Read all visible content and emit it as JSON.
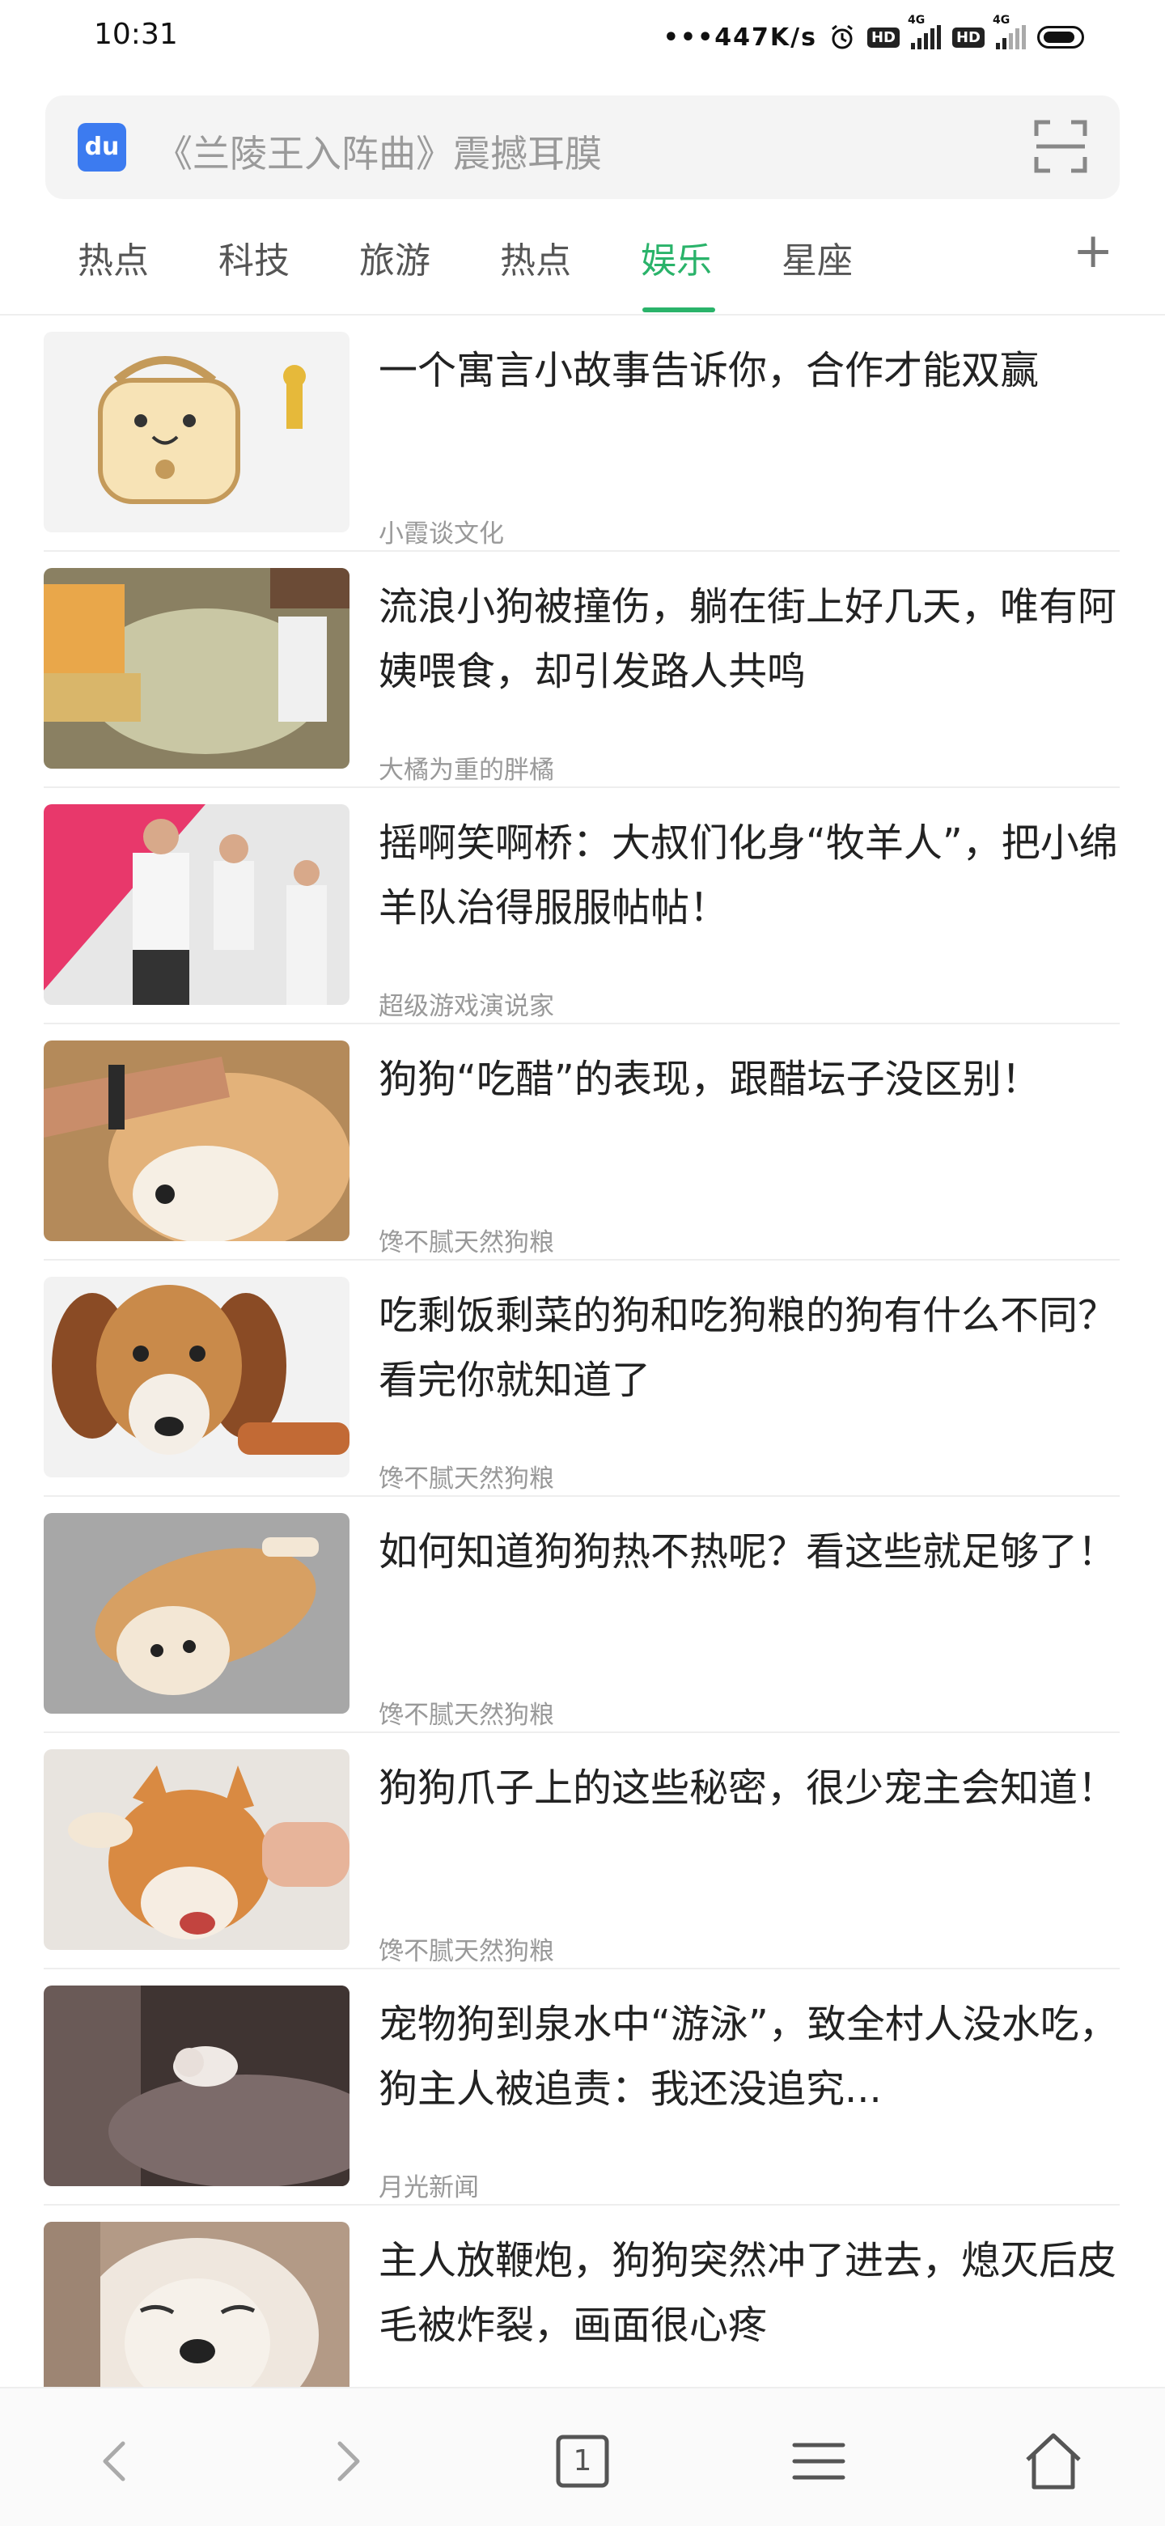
{
  "status_bar": {
    "time": "10:31",
    "network_speed": "•••447K/s",
    "hd": "HD",
    "net": "4G"
  },
  "search": {
    "placeholder": "《兰陵王入阵曲》震撼耳膜",
    "logo_text": "du"
  },
  "tabs": [
    {
      "label": "热点"
    },
    {
      "label": "科技"
    },
    {
      "label": "旅游"
    },
    {
      "label": "热点"
    },
    {
      "label": "娱乐",
      "active": true
    },
    {
      "label": "星座"
    }
  ],
  "tab_add": "+",
  "feed": [
    {
      "title": "一个寓言小故事告诉你，合作才能双赢",
      "source": "小霞谈文化",
      "thumb_icon": "cartoon-handbag-icon"
    },
    {
      "title": "流浪小狗被撞伤，躺在街上好几天，唯有阿姨喂食，却引发路人共鸣",
      "source": "大橘为重的胖橘",
      "thumb_icon": "injured-dog-photo"
    },
    {
      "title": "摇啊笑啊桥：大叔们化身“牧羊人”，把小绵羊队治得服服帖帖！",
      "source": "超级游戏演说家",
      "thumb_icon": "tv-show-photo"
    },
    {
      "title": "狗狗“吃醋”的表现，跟醋坛子没区别！",
      "source": "馋不腻天然狗粮",
      "thumb_icon": "shiba-photo"
    },
    {
      "title": "吃剩饭剩菜的狗和吃狗粮的狗有什么不同？看完你就知道了",
      "source": "馋不腻天然狗粮",
      "thumb_icon": "beagle-photo"
    },
    {
      "title": "如何知道狗狗热不热呢？看这些就足够了！",
      "source": "馋不腻天然狗粮",
      "thumb_icon": "shiba-floor-photo"
    },
    {
      "title": "狗狗爪子上的这些秘密，很少宠主会知道！",
      "source": "馋不腻天然狗粮",
      "thumb_icon": "shiba-paw-photo"
    },
    {
      "title": "宠物狗到泉水中“游泳”，致全村人没水吃，狗主人被追责：我还没追究...",
      "source": "月光新闻",
      "thumb_icon": "kitten-photo"
    },
    {
      "title": "主人放鞭炮，狗狗突然冲了进去，熄灭后皮毛被炸裂，画面很心疼",
      "source": "",
      "thumb_icon": "burned-dog-photo"
    }
  ],
  "bottom_nav": {
    "tab_count": "1"
  }
}
